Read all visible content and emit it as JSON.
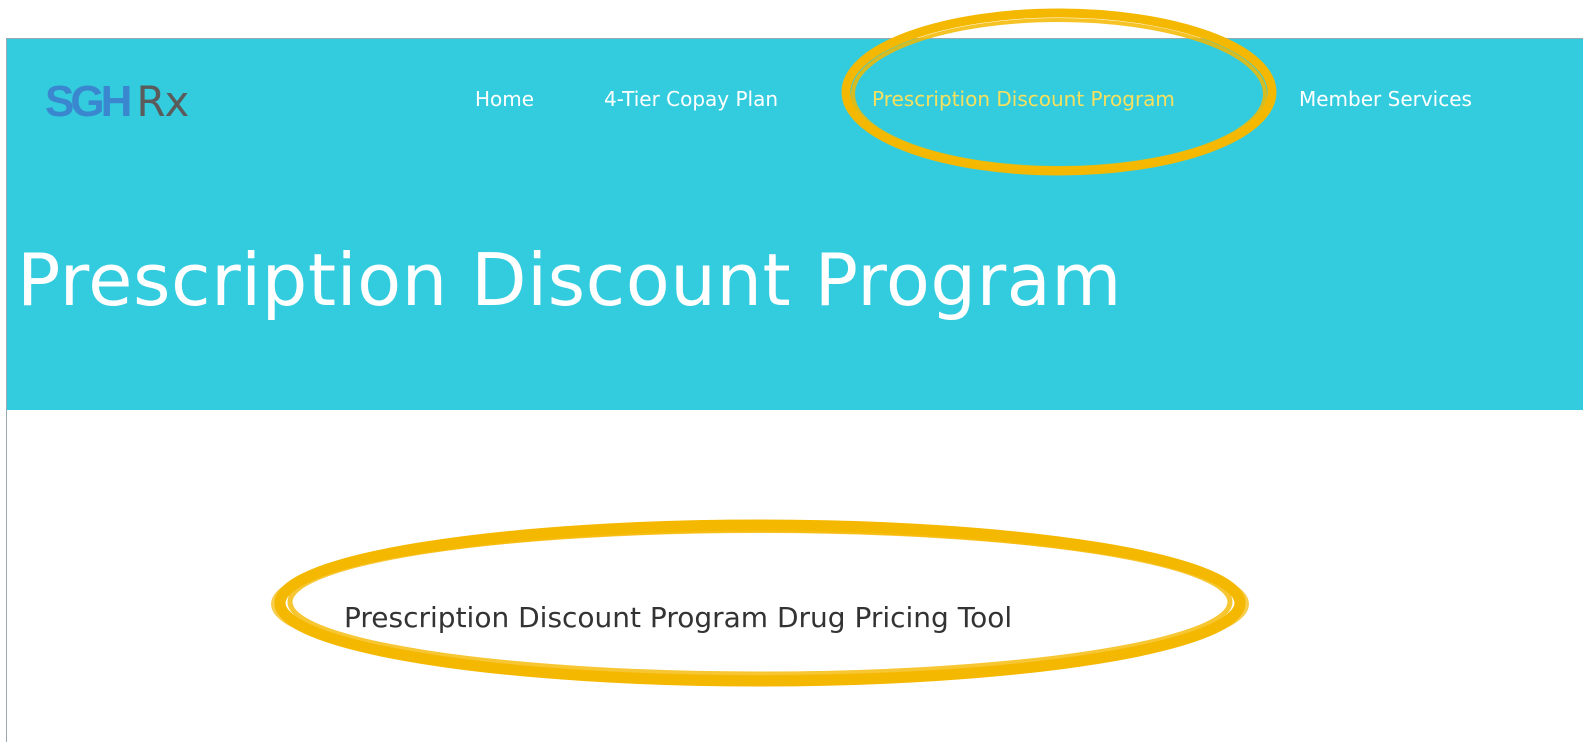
{
  "logo": {
    "primary": "SGH",
    "secondary": "Rx"
  },
  "nav": {
    "items": [
      {
        "label": "Home",
        "active": false
      },
      {
        "label": "4-Tier Copay Plan",
        "active": false
      },
      {
        "label": "Prescription Discount Program",
        "active": true
      },
      {
        "label": "Member Services",
        "active": false
      }
    ]
  },
  "hero": {
    "title": "Prescription Discount Program"
  },
  "main": {
    "tool_link": "Prescription Discount Program Drug Pricing Tool"
  },
  "colors": {
    "hero_bg": "#33ccdf",
    "active_nav": "#f6e05e",
    "highlight_ring": "#f5b800",
    "logo_sgh": "#3a86cf",
    "logo_rx": "#5b5b5b"
  }
}
